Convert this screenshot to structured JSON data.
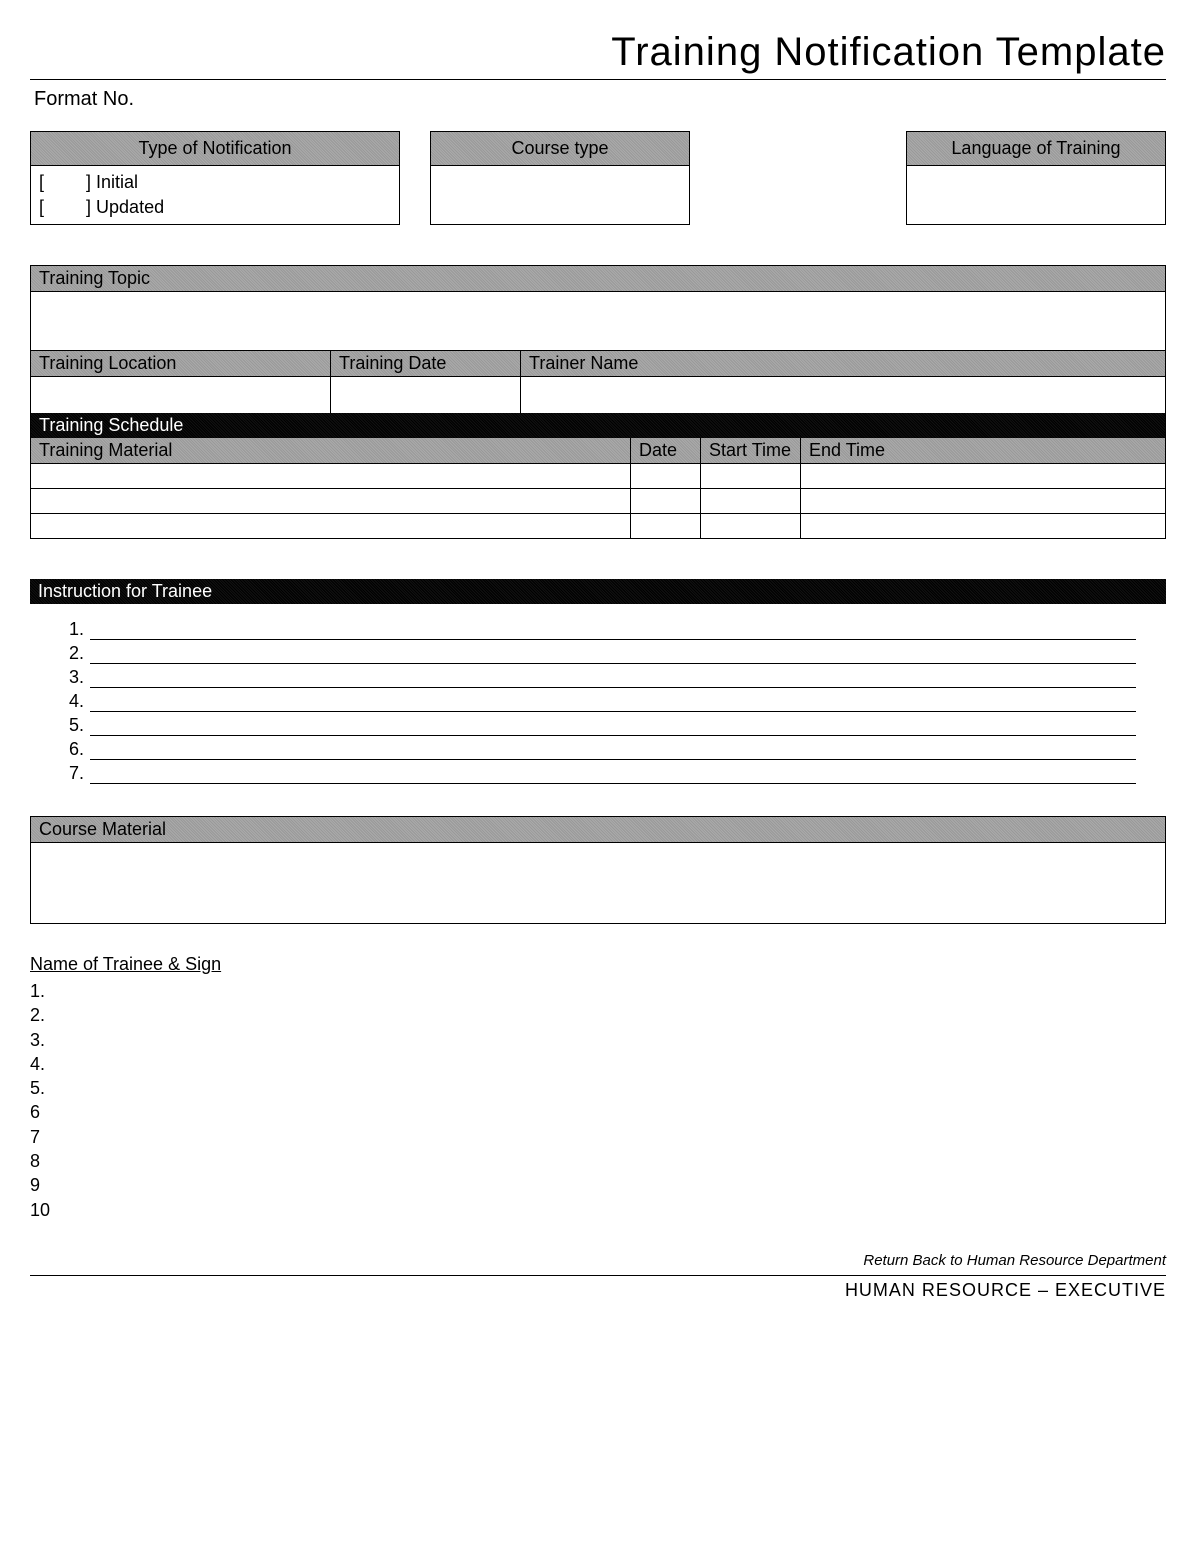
{
  "title": "Training Notification Template",
  "format_label": "Format No.",
  "boxes": {
    "notification": {
      "header": "Type of Notification",
      "option1": "Initial",
      "option2": "Updated"
    },
    "course": {
      "header": "Course type"
    },
    "language": {
      "header": "Language of Training"
    }
  },
  "main": {
    "topic": "Training Topic",
    "location": "Training Location",
    "date": "Training Date",
    "trainer": "Trainer Name",
    "schedule": "Training Schedule",
    "material": "Training Material",
    "col_date": "Date",
    "col_start": "Start Time",
    "col_end": "End Time"
  },
  "instruction_header": "Instruction for Trainee",
  "instructions": [
    "1.",
    "2.",
    "3.",
    "4.",
    "5.",
    "6.",
    "7."
  ],
  "course_material": "Course Material",
  "trainee_sign_heading": "Name of Trainee & Sign",
  "trainee_lines": [
    "1.",
    "2.",
    "3.",
    "4.",
    "5.",
    "6",
    "7",
    "8",
    "9",
    "10"
  ],
  "return_note": "Return Back to Human Resource Department",
  "footer_dept": "HUMAN RESOURCE – EXECUTIVE"
}
